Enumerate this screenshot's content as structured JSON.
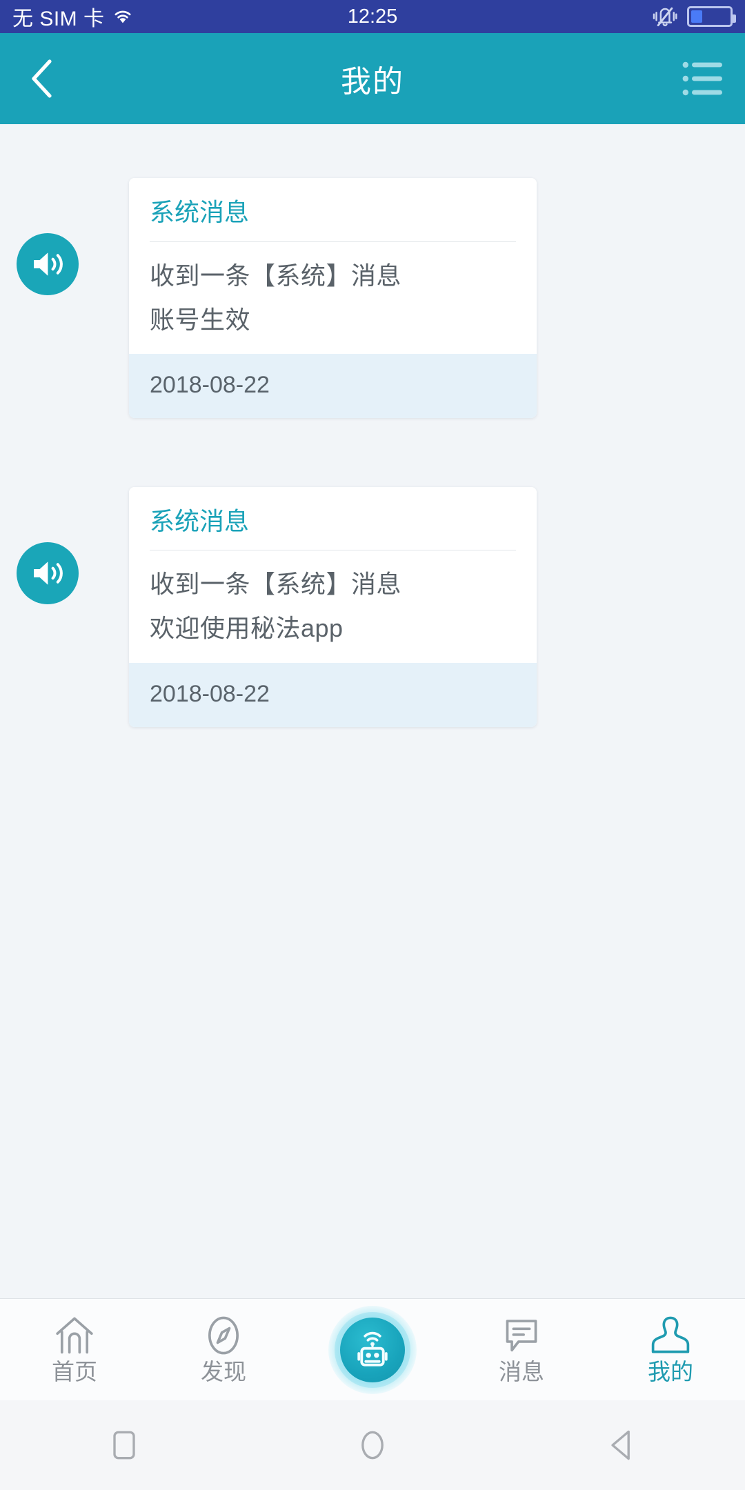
{
  "status_bar": {
    "carrier": "无 SIM 卡",
    "time": "12:25",
    "icons": [
      "wifi-icon",
      "mute-icon",
      "battery-icon"
    ],
    "battery_level_percent": 30,
    "background_color": "#2f3f9e"
  },
  "header": {
    "title": "我的",
    "back_icon": "chevron-left-icon",
    "menu_icon": "list-menu-icon",
    "background_color": "#1aa2b8"
  },
  "messages": [
    {
      "avatar_icon": "speaker-icon",
      "title": "系统消息",
      "line1": "收到一条【系统】消息",
      "line2": "账号生效",
      "date": "2018-08-22"
    },
    {
      "avatar_icon": "speaker-icon",
      "title": "系统消息",
      "line1": "收到一条【系统】消息",
      "line2": "欢迎使用秘法app",
      "date": "2018-08-22"
    }
  ],
  "tabbar": {
    "items": [
      {
        "label": "首页",
        "icon": "home-icon",
        "active": false
      },
      {
        "label": "发现",
        "icon": "compass-icon",
        "active": false
      },
      {
        "label": "",
        "icon": "robot-icon",
        "active": false
      },
      {
        "label": "消息",
        "icon": "chat-bubble-icon",
        "active": false
      },
      {
        "label": "我的",
        "icon": "person-icon",
        "active": true
      }
    ],
    "active_color": "#1f9bb0",
    "inactive_color": "#8d9298"
  },
  "system_nav": {
    "recents_icon": "square-icon",
    "home_icon": "circle-icon",
    "back_icon": "triangle-left-icon"
  },
  "colors": {
    "page_background": "#f2f5f8",
    "card_background": "#ffffff",
    "card_date_background": "#e5f1f9",
    "accent": "#1aa2b8"
  }
}
